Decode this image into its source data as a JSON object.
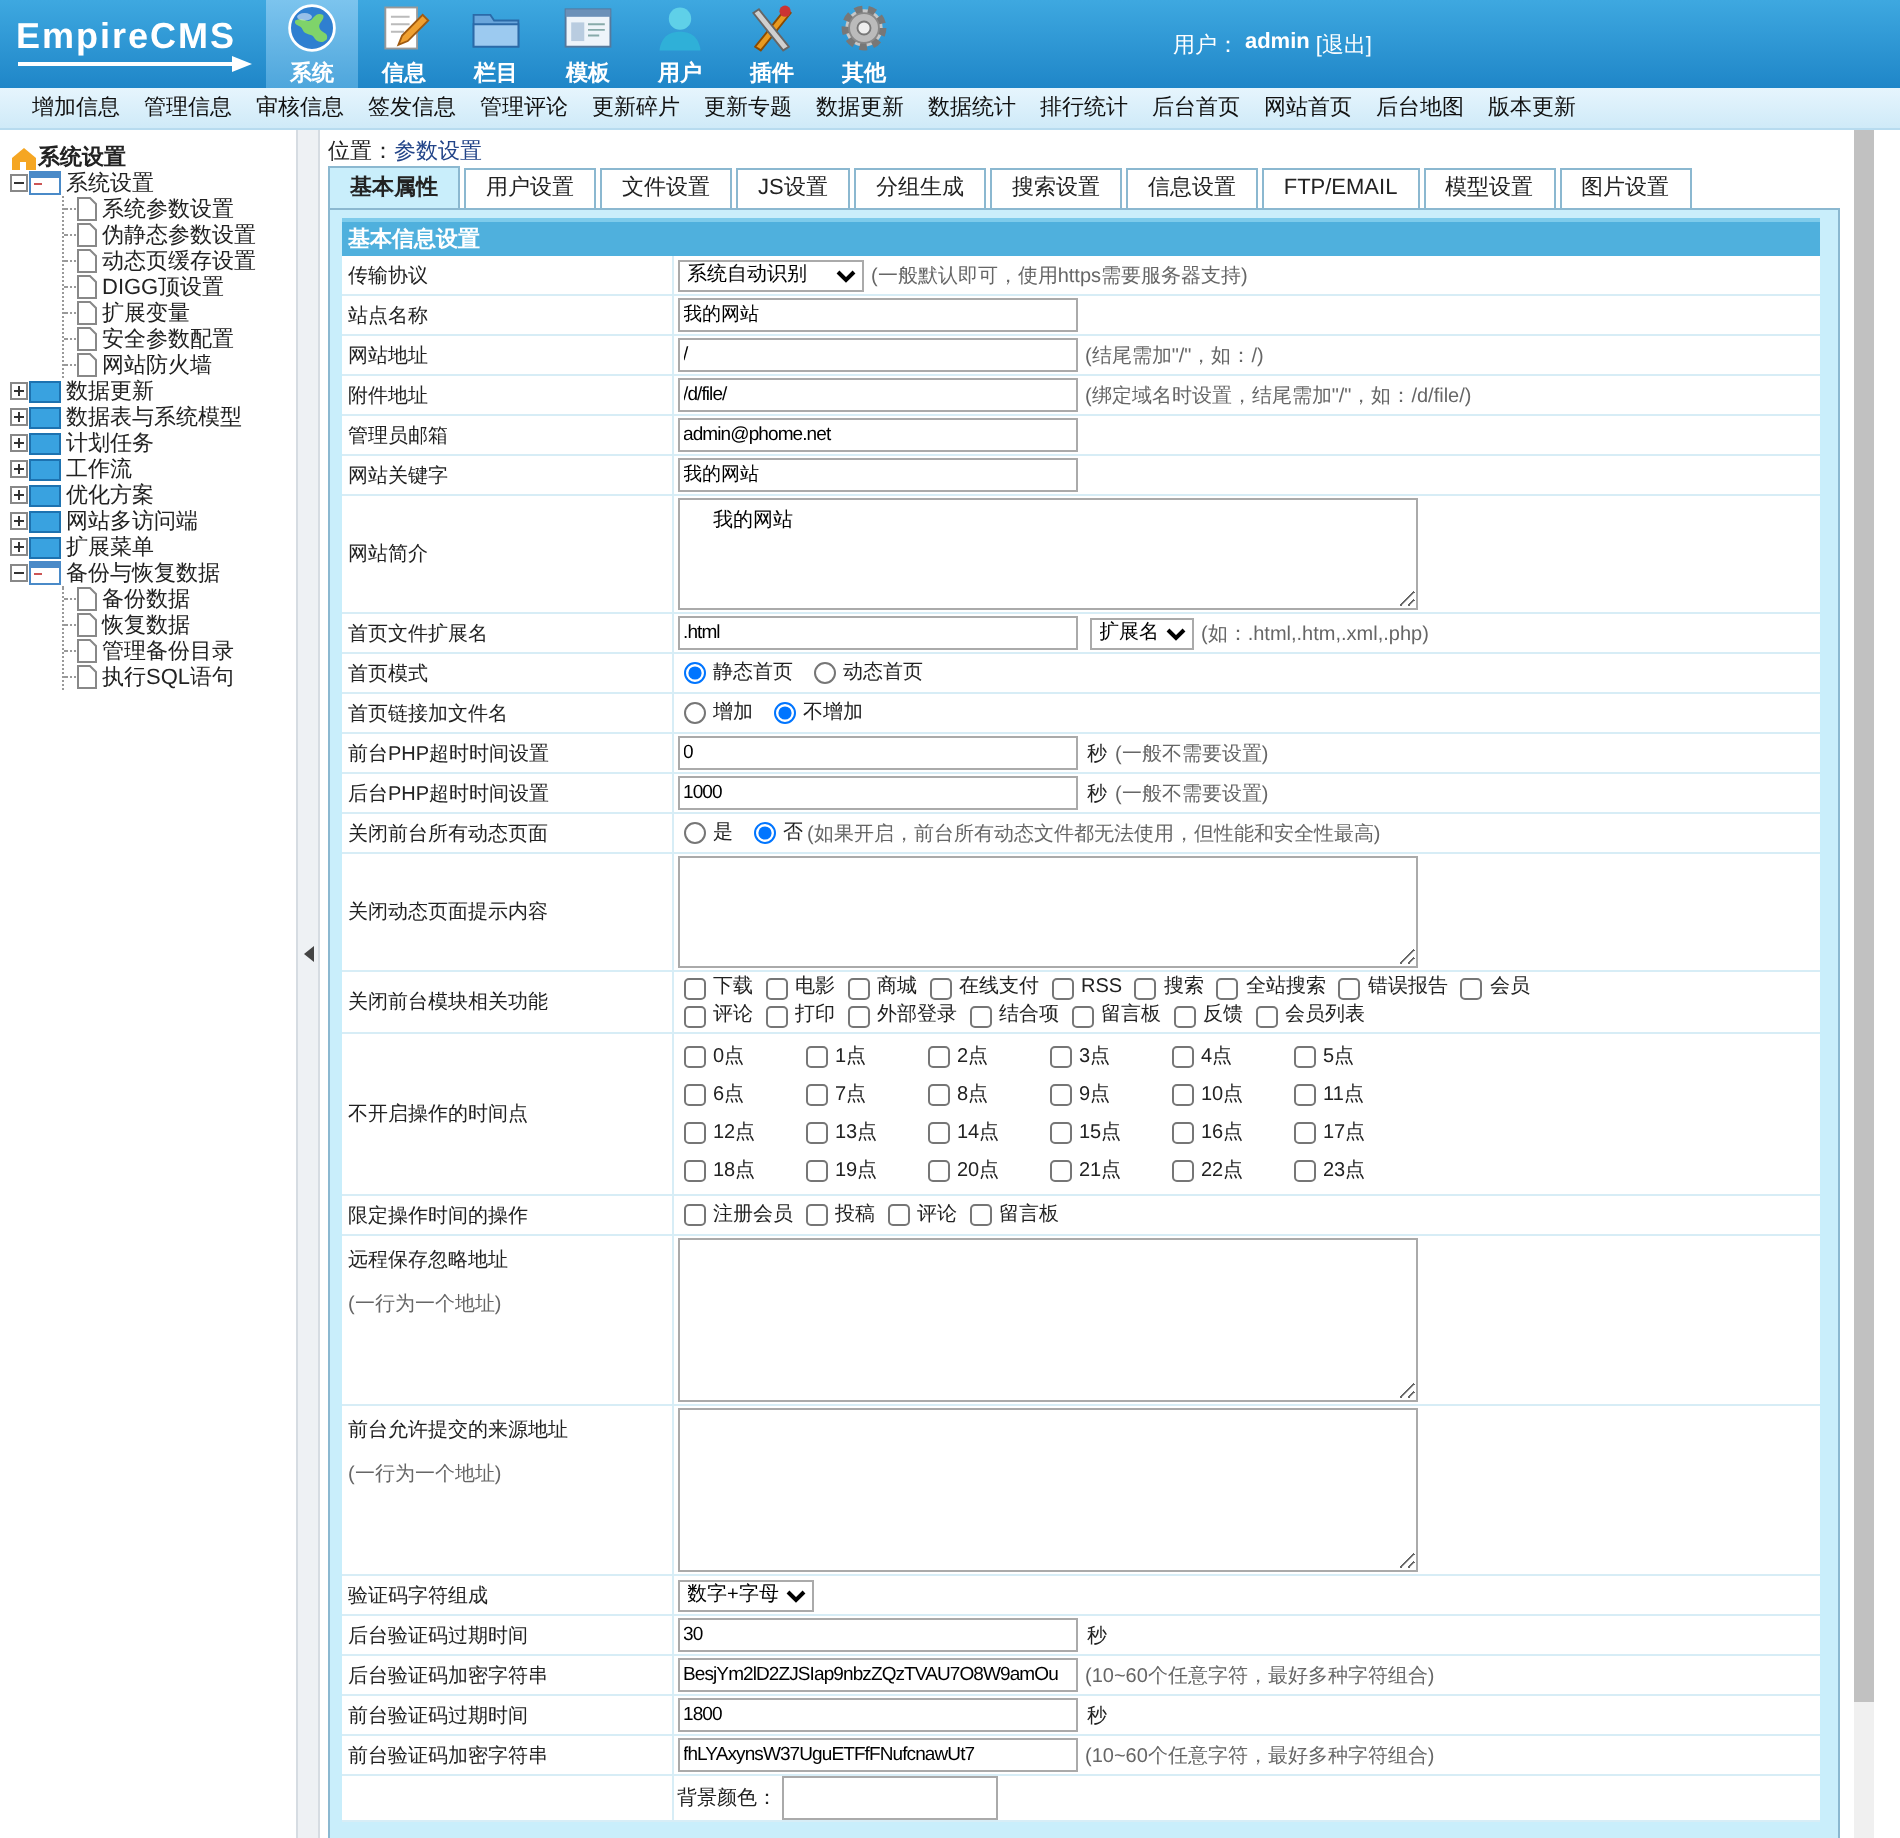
{
  "header": {
    "logo": "EmpireCMS",
    "nav": [
      {
        "label": "系统",
        "selected": true
      },
      {
        "label": "信息",
        "selected": false
      },
      {
        "label": "栏目",
        "selected": false
      },
      {
        "label": "模板",
        "selected": false
      },
      {
        "label": "用户",
        "selected": false
      },
      {
        "label": "插件",
        "selected": false
      },
      {
        "label": "其他",
        "selected": false
      }
    ],
    "user_label": "用户：",
    "username": "admin",
    "logout": "[退出]"
  },
  "menu": [
    "增加信息",
    "管理信息",
    "审核信息",
    "签发信息",
    "管理评论",
    "更新碎片",
    "更新专题",
    "数据更新",
    "数据统计",
    "排行统计",
    "后台首页",
    "网站首页",
    "后台地图",
    "版本更新"
  ],
  "tree": {
    "root": "系统设置",
    "items": [
      {
        "label": "系统设置",
        "expanded": true,
        "children": [
          {
            "label": "系统参数设置"
          },
          {
            "label": "伪静态参数设置"
          },
          {
            "label": "动态页缓存设置"
          },
          {
            "label": "DIGG顶设置"
          },
          {
            "label": "扩展变量"
          },
          {
            "label": "安全参数配置"
          },
          {
            "label": "网站防火墙"
          }
        ]
      },
      {
        "label": "数据更新",
        "expanded": false
      },
      {
        "label": "数据表与系统模型",
        "expanded": false
      },
      {
        "label": "计划任务",
        "expanded": false
      },
      {
        "label": "工作流",
        "expanded": false
      },
      {
        "label": "优化方案",
        "expanded": false
      },
      {
        "label": "网站多访问端",
        "expanded": false
      },
      {
        "label": "扩展菜单",
        "expanded": false
      },
      {
        "label": "备份与恢复数据",
        "expanded": true,
        "children": [
          {
            "label": "备份数据"
          },
          {
            "label": "恢复数据"
          },
          {
            "label": "管理备份目录"
          },
          {
            "label": "执行SQL语句"
          }
        ]
      }
    ]
  },
  "location": {
    "label": "位置：",
    "page": "参数设置"
  },
  "tabs": [
    {
      "label": "基本属性",
      "selected": true
    },
    {
      "label": "用户设置",
      "selected": false
    },
    {
      "label": "文件设置",
      "selected": false
    },
    {
      "label": "JS设置",
      "selected": false
    },
    {
      "label": "分组生成",
      "selected": false
    },
    {
      "label": "搜索设置",
      "selected": false
    },
    {
      "label": "信息设置",
      "selected": false
    },
    {
      "label": "FTP/EMAIL",
      "selected": false
    },
    {
      "label": "模型设置",
      "selected": false
    },
    {
      "label": "图片设置",
      "selected": false
    }
  ],
  "form": {
    "title": "基本信息设置",
    "rows": [
      {
        "kind": "select",
        "label": "传输协议",
        "value": "系统自动识别",
        "hint": "(一般默认即可，使用https需要服务器支持)"
      },
      {
        "kind": "text",
        "label": "站点名称",
        "value": "我的网站"
      },
      {
        "kind": "text",
        "label": "网站地址",
        "value": "/",
        "hint": "(结尾需加\"/\"，如：/)"
      },
      {
        "kind": "text",
        "label": "附件地址",
        "value": "/d/file/",
        "hint": "(绑定域名时设置，结尾需加\"/\"，如：/d/file/)"
      },
      {
        "kind": "text",
        "label": "管理员邮箱",
        "value": "admin@phome.net"
      },
      {
        "kind": "text",
        "label": "网站关键字",
        "value": "我的网站"
      },
      {
        "kind": "textarea",
        "label": "网站简介",
        "value": "我的网站"
      },
      {
        "kind": "text_select",
        "label": "首页文件扩展名",
        "value": ".html",
        "select": "扩展名",
        "hint": "(如：.html,.htm,.xml,.php)"
      },
      {
        "kind": "radios",
        "label": "首页模式",
        "options": [
          {
            "label": "静态首页",
            "selected": true
          },
          {
            "label": "动态首页",
            "selected": false
          }
        ]
      },
      {
        "kind": "radios",
        "label": "首页链接加文件名",
        "options": [
          {
            "label": "增加",
            "selected": false
          },
          {
            "label": "不增加",
            "selected": true
          }
        ]
      },
      {
        "kind": "text",
        "label": "前台PHP超时时间设置",
        "value": "0",
        "suffix": "秒",
        "hint": "(一般不需要设置)"
      },
      {
        "kind": "text",
        "label": "后台PHP超时时间设置",
        "value": "1000",
        "suffix": "秒",
        "hint": "(一般不需要设置)"
      },
      {
        "kind": "radios",
        "label": "关闭前台所有动态页面",
        "options": [
          {
            "label": "是",
            "selected": false
          },
          {
            "label": "否",
            "selected": true
          }
        ],
        "hint": "(如果开启，前台所有动态文件都无法使用，但性能和安全性最高)"
      },
      {
        "kind": "textarea",
        "label": "关闭动态页面提示内容"
      },
      {
        "kind": "checks",
        "label": "关闭前台模块相关功能",
        "options": [
          {
            "label": "下载",
            "checked": false
          },
          {
            "label": "电影",
            "checked": false
          },
          {
            "label": "商城",
            "checked": false
          },
          {
            "label": "在线支付",
            "checked": false
          },
          {
            "label": "RSS",
            "checked": false
          },
          {
            "label": "搜索",
            "checked": false
          },
          {
            "label": "全站搜索",
            "checked": false
          },
          {
            "label": "错误报告",
            "checked": false
          },
          {
            "label": "会员",
            "checked": false
          },
          {
            "label": "评论",
            "checked": false
          },
          {
            "label": "打印",
            "checked": false
          },
          {
            "label": "外部登录",
            "checked": false
          },
          {
            "label": "结合项",
            "checked": false
          },
          {
            "label": "留言板",
            "checked": false
          },
          {
            "label": "反馈",
            "checked": false
          },
          {
            "label": "会员列表",
            "checked": false
          }
        ]
      },
      {
        "kind": "hours",
        "label": "不开启操作的时间点",
        "options": [
          {
            "label": "0点",
            "checked": false
          },
          {
            "label": "1点",
            "checked": false
          },
          {
            "label": "2点",
            "checked": false
          },
          {
            "label": "3点",
            "checked": false
          },
          {
            "label": "4点",
            "checked": false
          },
          {
            "label": "5点",
            "checked": false
          },
          {
            "label": "6点",
            "checked": false
          },
          {
            "label": "7点",
            "checked": false
          },
          {
            "label": "8点",
            "checked": false
          },
          {
            "label": "9点",
            "checked": false
          },
          {
            "label": "10点",
            "checked": false
          },
          {
            "label": "11点",
            "checked": false
          },
          {
            "label": "12点",
            "checked": false
          },
          {
            "label": "13点",
            "checked": false
          },
          {
            "label": "14点",
            "checked": false
          },
          {
            "label": "15点",
            "checked": false
          },
          {
            "label": "16点",
            "checked": false
          },
          {
            "label": "17点",
            "checked": false
          },
          {
            "label": "18点",
            "checked": false
          },
          {
            "label": "19点",
            "checked": false
          },
          {
            "label": "20点",
            "checked": false
          },
          {
            "label": "21点",
            "checked": false
          },
          {
            "label": "22点",
            "checked": false
          },
          {
            "label": "23点",
            "checked": false
          }
        ]
      },
      {
        "kind": "checks",
        "label": "限定操作时间的操作",
        "options": [
          {
            "label": "注册会员",
            "checked": false
          },
          {
            "label": "投稿",
            "checked": false
          },
          {
            "label": "评论",
            "checked": false
          },
          {
            "label": "留言板",
            "checked": false
          }
        ]
      },
      {
        "kind": "textarea",
        "label": "远程保存忽略地址",
        "note": "(一行为一个地址)"
      },
      {
        "kind": "textarea",
        "label": "前台允许提交的来源地址",
        "note": "(一行为一个地址)"
      },
      {
        "kind": "select",
        "label": "验证码字符组成",
        "value": "数字+字母"
      },
      {
        "kind": "text",
        "label": "后台验证码过期时间",
        "value": "30",
        "suffix": "秒"
      },
      {
        "kind": "text",
        "label": "后台验证码加密字符串",
        "value": "BesjYm2lD2ZJSIap9nbzZQzTVAU7O8W9amOu",
        "hint": "(10~60个任意字符，最好多种字符组合)"
      },
      {
        "kind": "text",
        "label": "前台验证码过期时间",
        "value": "1800",
        "suffix": "秒"
      },
      {
        "kind": "text",
        "label": "前台验证码加密字符串",
        "value": "fhLYAxynsW37UguETFfFNufcnawUt7",
        "hint": "(10~60个任意字符，最好多种字符组合)"
      },
      {
        "kind": "color",
        "field_label": "背景颜色："
      }
    ]
  }
}
